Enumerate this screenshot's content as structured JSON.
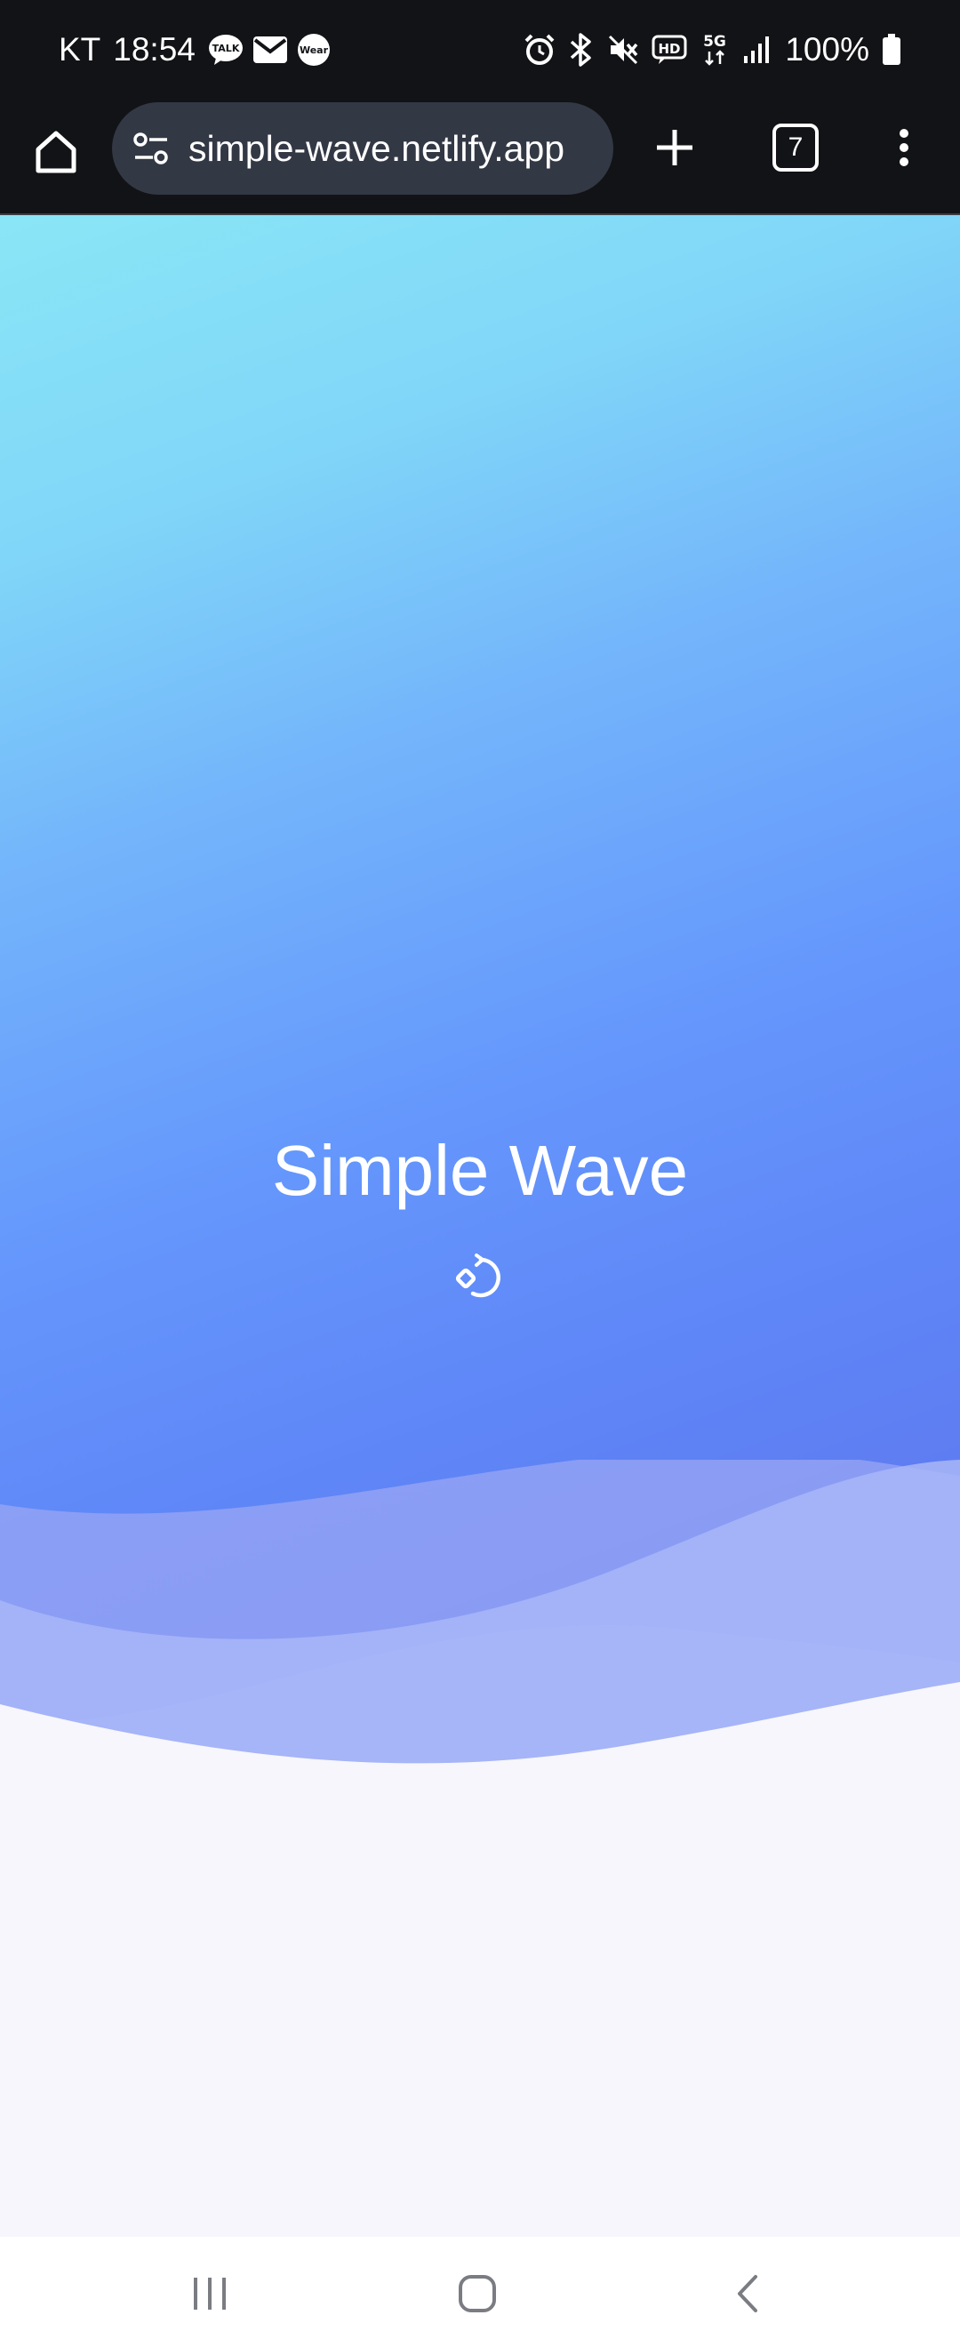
{
  "status_bar": {
    "carrier": "KT",
    "time": "18:54",
    "battery_percent": "100%",
    "notification_icons": [
      "talk-icon",
      "mail-icon",
      "wear-icon"
    ],
    "system_icons": [
      "alarm-icon",
      "bluetooth-icon",
      "mute-icon",
      "hd-icon",
      "5g-icon",
      "signal-icon",
      "battery-icon"
    ]
  },
  "browser": {
    "url": "simple-wave.netlify.app",
    "tab_count": "7"
  },
  "page": {
    "title": "Simple Wave"
  },
  "colors": {
    "gradient_top": "#8ae6f6",
    "gradient_bottom": "#5b6fe9",
    "page_background": "#f6f6fc",
    "toolbar_background": "#121316",
    "url_pill": "#333845"
  }
}
